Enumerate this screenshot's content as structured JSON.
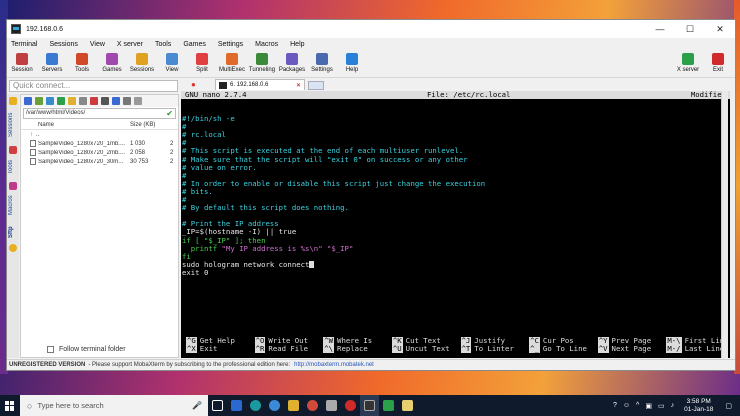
{
  "window": {
    "title": "192.168.0.6",
    "controls": [
      "—",
      "☐",
      "✕"
    ]
  },
  "menubar": [
    "Terminal",
    "Sessions",
    "View",
    "X server",
    "Tools",
    "Games",
    "Settings",
    "Macros",
    "Help"
  ],
  "toolbar": {
    "left": [
      {
        "label": "Session",
        "color": "#c04040"
      },
      {
        "label": "Servers",
        "color": "#3a7ad0"
      },
      {
        "label": "Tools",
        "color": "#d04a2a"
      },
      {
        "label": "Games",
        "color": "#a04ab0"
      },
      {
        "label": "Sessions",
        "color": "#e0a020"
      },
      {
        "label": "View",
        "color": "#4a8ad0"
      },
      {
        "label": "Split",
        "color": "#e04040"
      },
      {
        "label": "MultiExec",
        "color": "#e06a2a"
      },
      {
        "label": "Tunneling",
        "color": "#3a8a3a"
      },
      {
        "label": "Packages",
        "color": "#6a5ac0"
      },
      {
        "label": "Settings",
        "color": "#4a6ab0"
      },
      {
        "label": "Help",
        "color": "#2a80d8"
      }
    ],
    "right": [
      {
        "label": "X server",
        "color": "#2aa04a"
      },
      {
        "label": "Exit",
        "color": "#d02a2a"
      }
    ]
  },
  "left_panel": {
    "quick_connect_placeholder": "Quick connect...",
    "side_tabs": [
      "Sessions",
      "Tools",
      "Macros",
      "Sftp"
    ],
    "path": "/var/www/html/Videos/",
    "columns": {
      "name": "Name",
      "size": "Size (KB)"
    },
    "parent_dir": "..",
    "files": [
      {
        "name": "SampleVideo_1280x720_1mb....",
        "size": "1 030",
        "x": "2"
      },
      {
        "name": "SampleVideo_1280x720_2mb....",
        "size": "2 058",
        "x": "2"
      },
      {
        "name": "SampleVideo_1280x720_30m...",
        "size": "30 753",
        "x": "2"
      }
    ],
    "follow_label": "Follow terminal folder"
  },
  "tab": {
    "label": "6. 192.168.0.6",
    "close": "✕"
  },
  "nano": {
    "version": "GNU nano 2.7.4",
    "file": "File: /etc/rc.local",
    "state": "Modified"
  },
  "code": {
    "l1": "#!/bin/sh -e",
    "l2": "#",
    "l3": "# rc.local",
    "l4": "#",
    "l5": "# This script is executed at the end of each multiuser runlevel.",
    "l6": "# Make sure that the script will \"exit 0\" on success or any other",
    "l7": "# value on error.",
    "l8": "#",
    "l9": "# In order to enable or disable this script just change the execution",
    "l10": "# bits.",
    "l11": "#",
    "l12": "# By default this script does nothing.",
    "l13": "",
    "l14": "# Print the IP address",
    "l15a": "_IP=$(hostname -I) || true",
    "l16a": "if [ \"$_IP\" ]; then",
    "l17a": "  printf ",
    "l17b": "\"My IP address is %s\\n\" \"$_IP\"",
    "l18": "fi",
    "l19": "sudo hologram network connect",
    "l20": "exit 0"
  },
  "shortcuts": [
    [
      {
        "k": "^G",
        "t": "Get Help"
      },
      {
        "k": "^O",
        "t": "Write Out"
      },
      {
        "k": "^W",
        "t": "Where Is"
      },
      {
        "k": "^K",
        "t": "Cut Text"
      },
      {
        "k": "^J",
        "t": "Justify"
      },
      {
        "k": "^C",
        "t": "Cur Pos"
      },
      {
        "k": "^Y",
        "t": "Prev Page"
      },
      {
        "k": "M-\\",
        "t": "First Line"
      }
    ],
    [
      {
        "k": "^X",
        "t": "Exit"
      },
      {
        "k": "^R",
        "t": "Read File"
      },
      {
        "k": "^\\",
        "t": "Replace"
      },
      {
        "k": "^U",
        "t": "Uncut Text"
      },
      {
        "k": "^T",
        "t": "To Linter"
      },
      {
        "k": "^_",
        "t": "Go To Line"
      },
      {
        "k": "^V",
        "t": "Next Page"
      },
      {
        "k": "M-/",
        "t": "Last Line"
      }
    ]
  ],
  "status": {
    "bold": "UNREGISTERED VERSION",
    "text": "-  Please support MobaXterm by subscribing to the professional edition here:",
    "link": "http://mobaxterm.mobatek.net"
  },
  "taskbar": {
    "search_placeholder": "Type here to search",
    "time": "3:58 PM",
    "date": "01-Jan-18"
  }
}
